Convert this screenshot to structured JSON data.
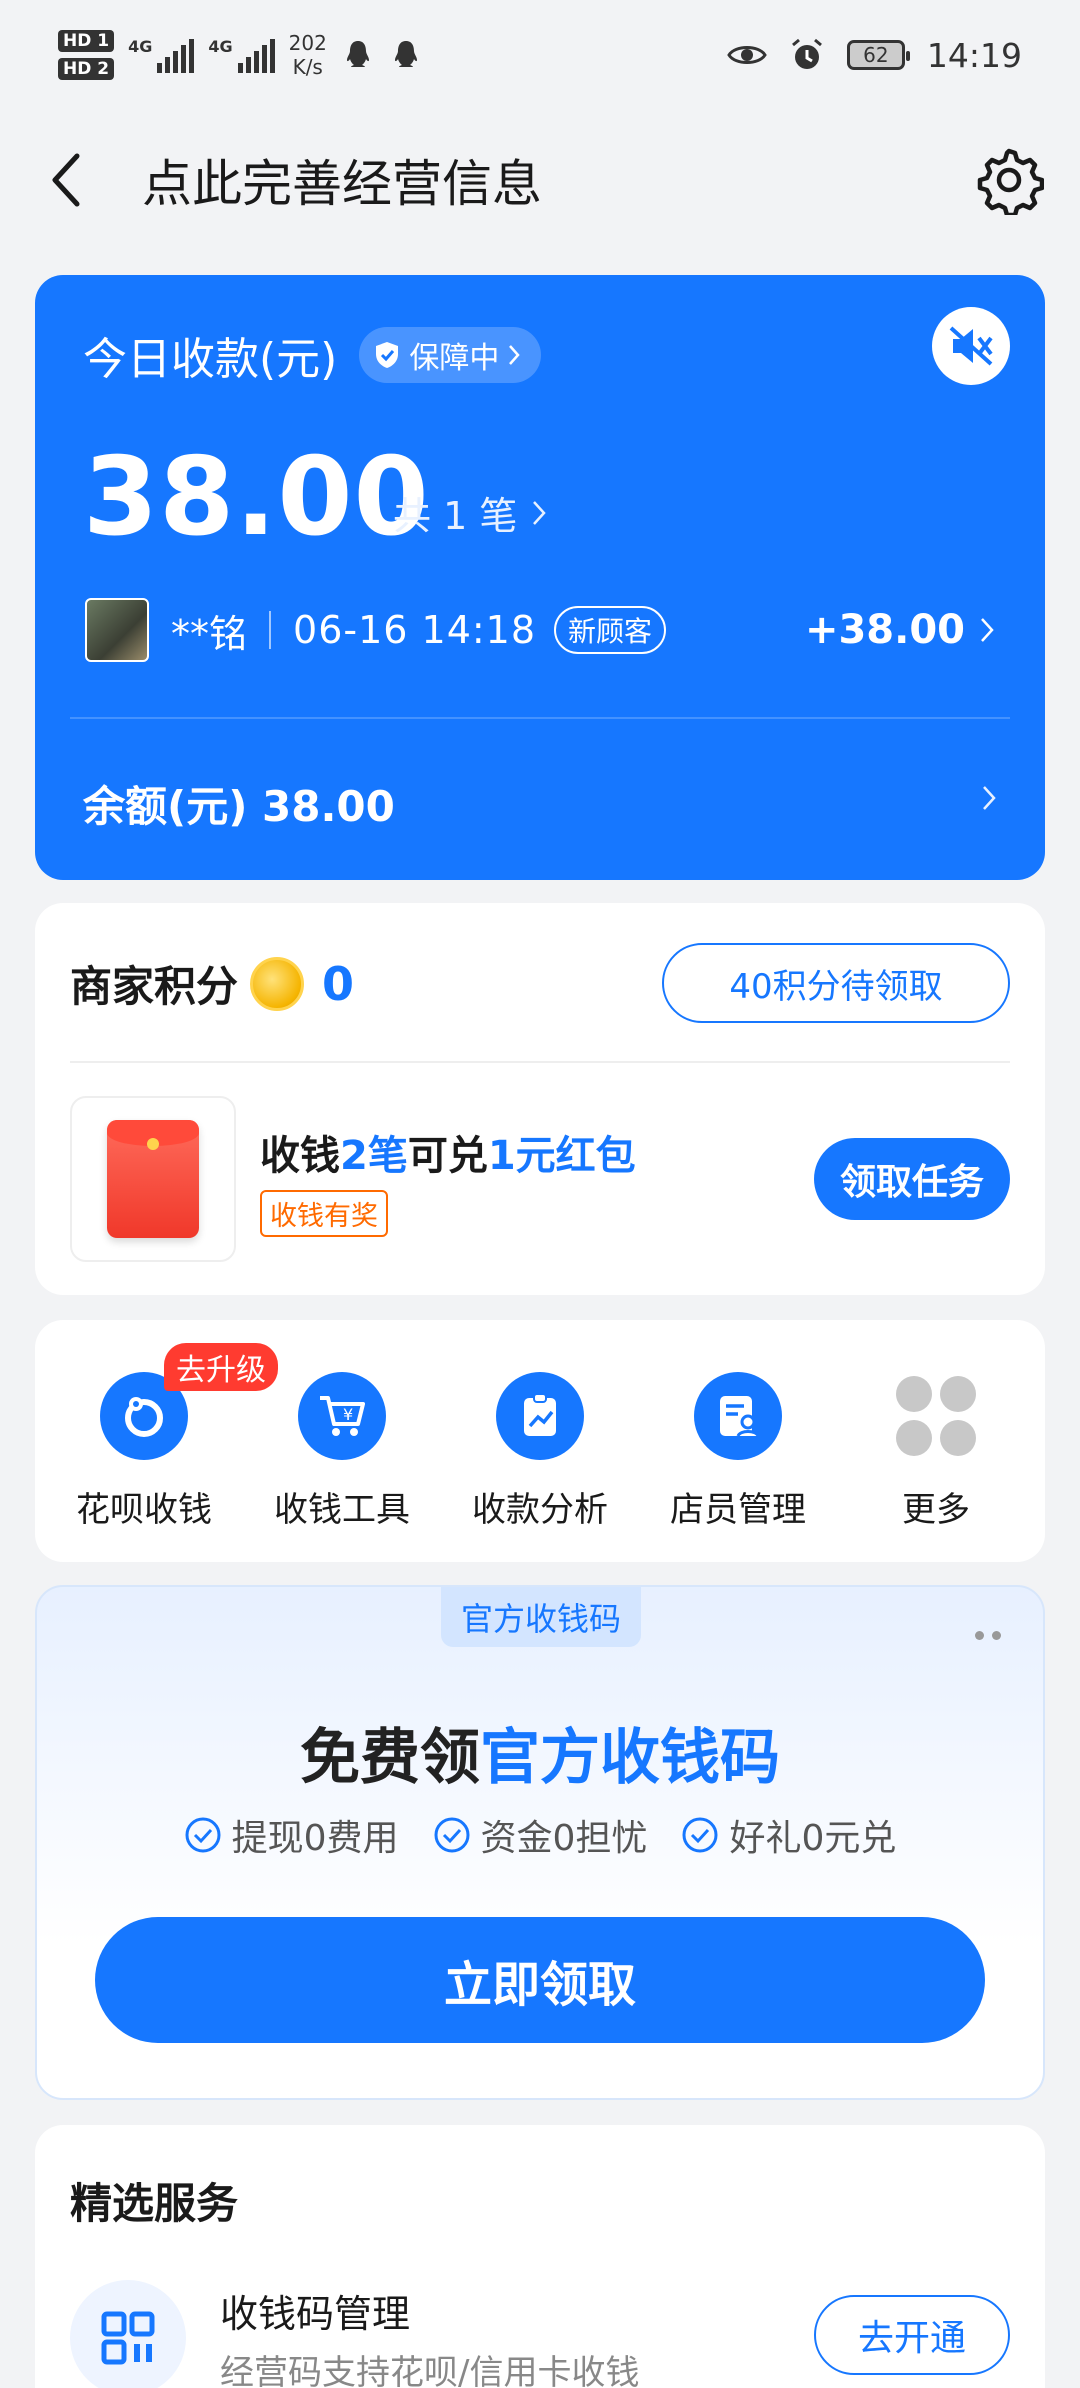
{
  "status_bar": {
    "sim1": "HD 1",
    "sim2": "HD 2",
    "net1": "4G",
    "net2": "4G",
    "speed_value": "202",
    "speed_unit": "K/s",
    "battery": "62",
    "time": "14:19"
  },
  "header": {
    "title": "点此完善经营信息"
  },
  "today_card": {
    "title": "今日收款(元)",
    "guard_label": "保障中",
    "amount": "38.00",
    "count_label": "共 1 笔",
    "tx_name": "**铭",
    "tx_time": "06-16 14:18",
    "tx_badge": "新顾客",
    "tx_amount": "+38.00",
    "balance_label": "余额(元) 38.00",
    "color": "#1677ff"
  },
  "points_card": {
    "title": "商家积分",
    "value": "0",
    "claim_label": "40积分待领取",
    "task_part1": "收钱",
    "task_hl1": "2笔",
    "task_part2": "可兑",
    "task_hl2": "1元红包",
    "task_tag": "收钱有奖",
    "task_button": "领取任务"
  },
  "quick_actions": {
    "upgrade_badge": "去升级",
    "items": [
      {
        "label": "花呗收钱",
        "icon": "huabei-icon"
      },
      {
        "label": "收钱工具",
        "icon": "cart-yuan-icon"
      },
      {
        "label": "收款分析",
        "icon": "analysis-chart-icon"
      },
      {
        "label": "店员管理",
        "icon": "staff-card-icon"
      },
      {
        "label": "更多",
        "icon": "more-grid-icon"
      }
    ]
  },
  "promo": {
    "tab_label": "官方收钱码",
    "title_part1": "免费领",
    "title_hl": "官方收钱码",
    "features": [
      "提现0费用",
      "资金0担忧",
      "好礼0元兑"
    ],
    "button": "立即领取"
  },
  "services": {
    "title": "精选服务",
    "item_name": "收钱码管理",
    "item_desc": "经营码支持花呗/信用卡收钱",
    "item_button": "去开通"
  }
}
